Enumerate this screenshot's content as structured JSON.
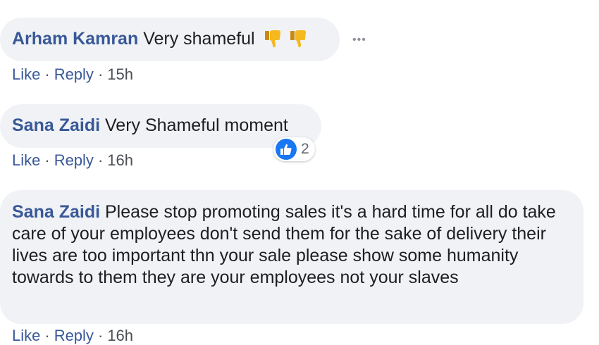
{
  "comments": [
    {
      "author": "Arham Kamran",
      "text": "Very shameful",
      "emojis": [
        "thumbs-down-icon",
        "thumbs-down-icon"
      ],
      "actions": {
        "like": "Like",
        "reply": "Reply",
        "time": "15h"
      }
    },
    {
      "author": "Sana Zaidi",
      "text": "Very Shameful moment",
      "reaction": {
        "icon": "thumbs-up-icon",
        "count": "2"
      },
      "actions": {
        "like": "Like",
        "reply": "Reply",
        "time": "16h"
      }
    },
    {
      "author": "Sana Zaidi",
      "text": "Please stop promoting sales it's a hard time for all do take care of your employees don't send them for the sake of delivery their lives are too important thn your sale please show some humanity towards to them they are your employees not your slaves",
      "actions": {
        "like": "Like",
        "reply": "Reply",
        "time": "16h"
      }
    }
  ],
  "separator": "·",
  "more_options": "•••",
  "colors": {
    "bubble": "#f0f2f5",
    "author": "#385898",
    "like_blue": "#1877f2",
    "thumb_yellow": "#f5b81f"
  }
}
